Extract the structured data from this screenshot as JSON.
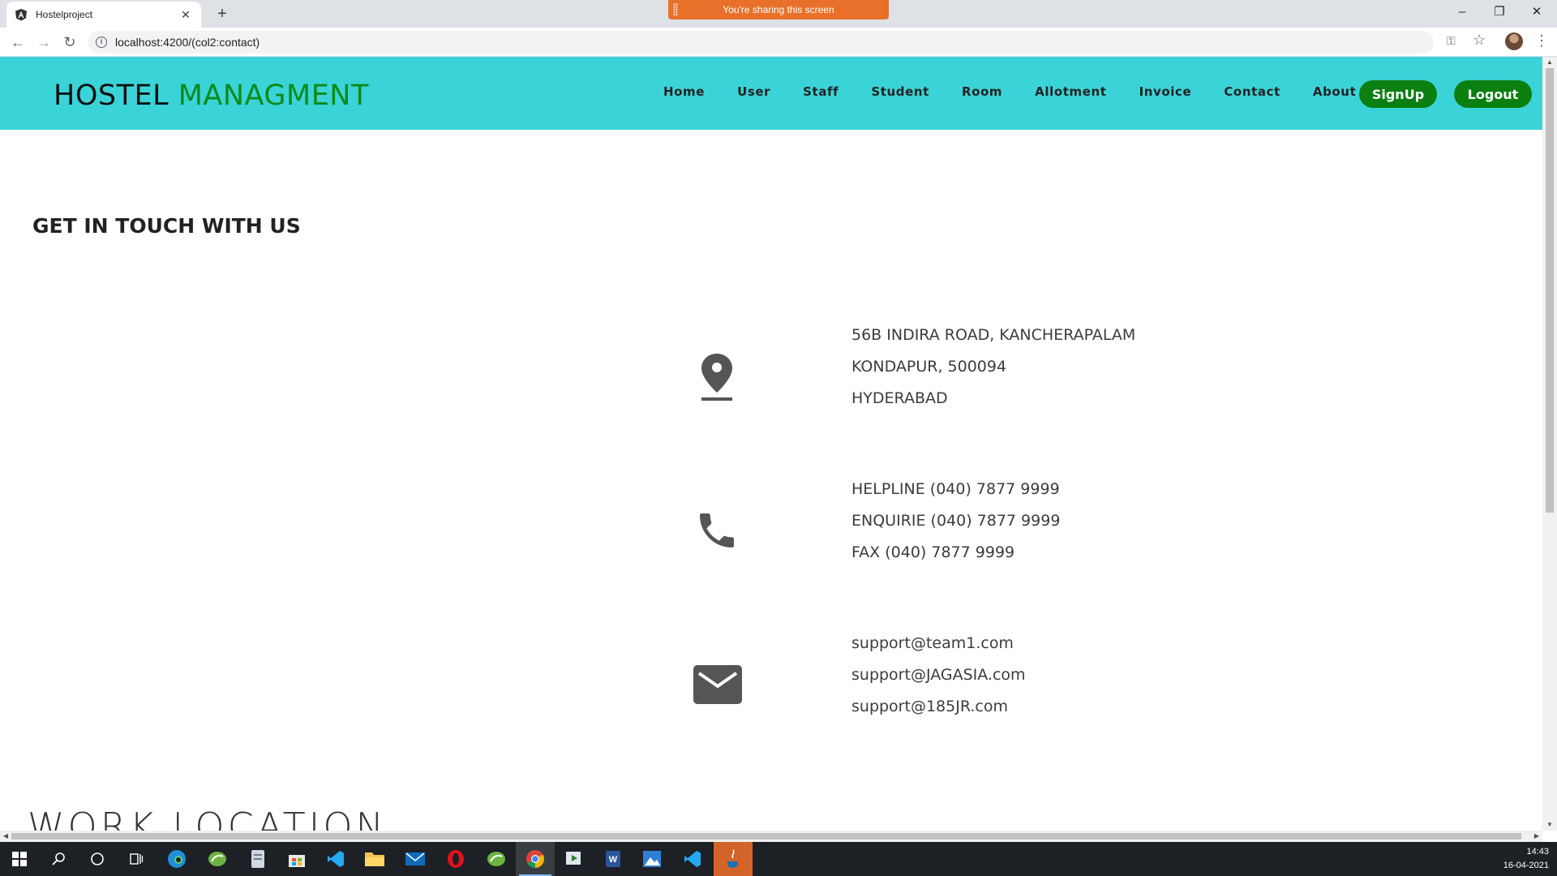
{
  "browser": {
    "tab_title": "Hostelproject",
    "url": "localhost:4200/(col2:contact)",
    "share_banner": "You're sharing this screen"
  },
  "app": {
    "brand_part1": "HOSTEL",
    "brand_part2": "MANAGMENT",
    "nav": [
      "Home",
      "User",
      "Staff",
      "Student",
      "Room",
      "Allotment",
      "Invoice",
      "Contact",
      "About"
    ],
    "signup_label": "SignUp",
    "logout_label": "Logout",
    "header_color": "#3ad4d8",
    "accent_green": "#0b7f10"
  },
  "contact": {
    "title": "GET IN TOUCH WITH US",
    "address": {
      "icon": "location-pin-icon",
      "lines": [
        "56B INDIRA ROAD, KANCHERAPALAM",
        "KONDAPUR, 500094",
        "HYDERABAD"
      ]
    },
    "phone": {
      "icon": "phone-icon",
      "lines": [
        "HELPLINE (040) 7877 9999",
        "ENQUIRIE (040) 7877 9999",
        "FAX (040) 7877 9999"
      ]
    },
    "email": {
      "icon": "envelope-icon",
      "lines": [
        "support@team1.com",
        "support@JAGASIA.com",
        "support@185JR.com"
      ]
    }
  },
  "work_location_title": "WORK LOCATION",
  "taskbar": {
    "apps": [
      "start-icon",
      "search-icon",
      "cortana-icon",
      "task-view-icon",
      "edge-icon",
      "spring-tool-icon",
      "notepad-icon",
      "store-icon",
      "vscode-icon",
      "file-explorer-icon",
      "mail-icon",
      "opera-icon",
      "spring-tool-icon-2",
      "chrome-icon",
      "media-player-icon",
      "word-icon",
      "photos-icon",
      "vscode-icon-2",
      "java-icon"
    ],
    "time": "14:43",
    "date": "16-04-2021"
  }
}
